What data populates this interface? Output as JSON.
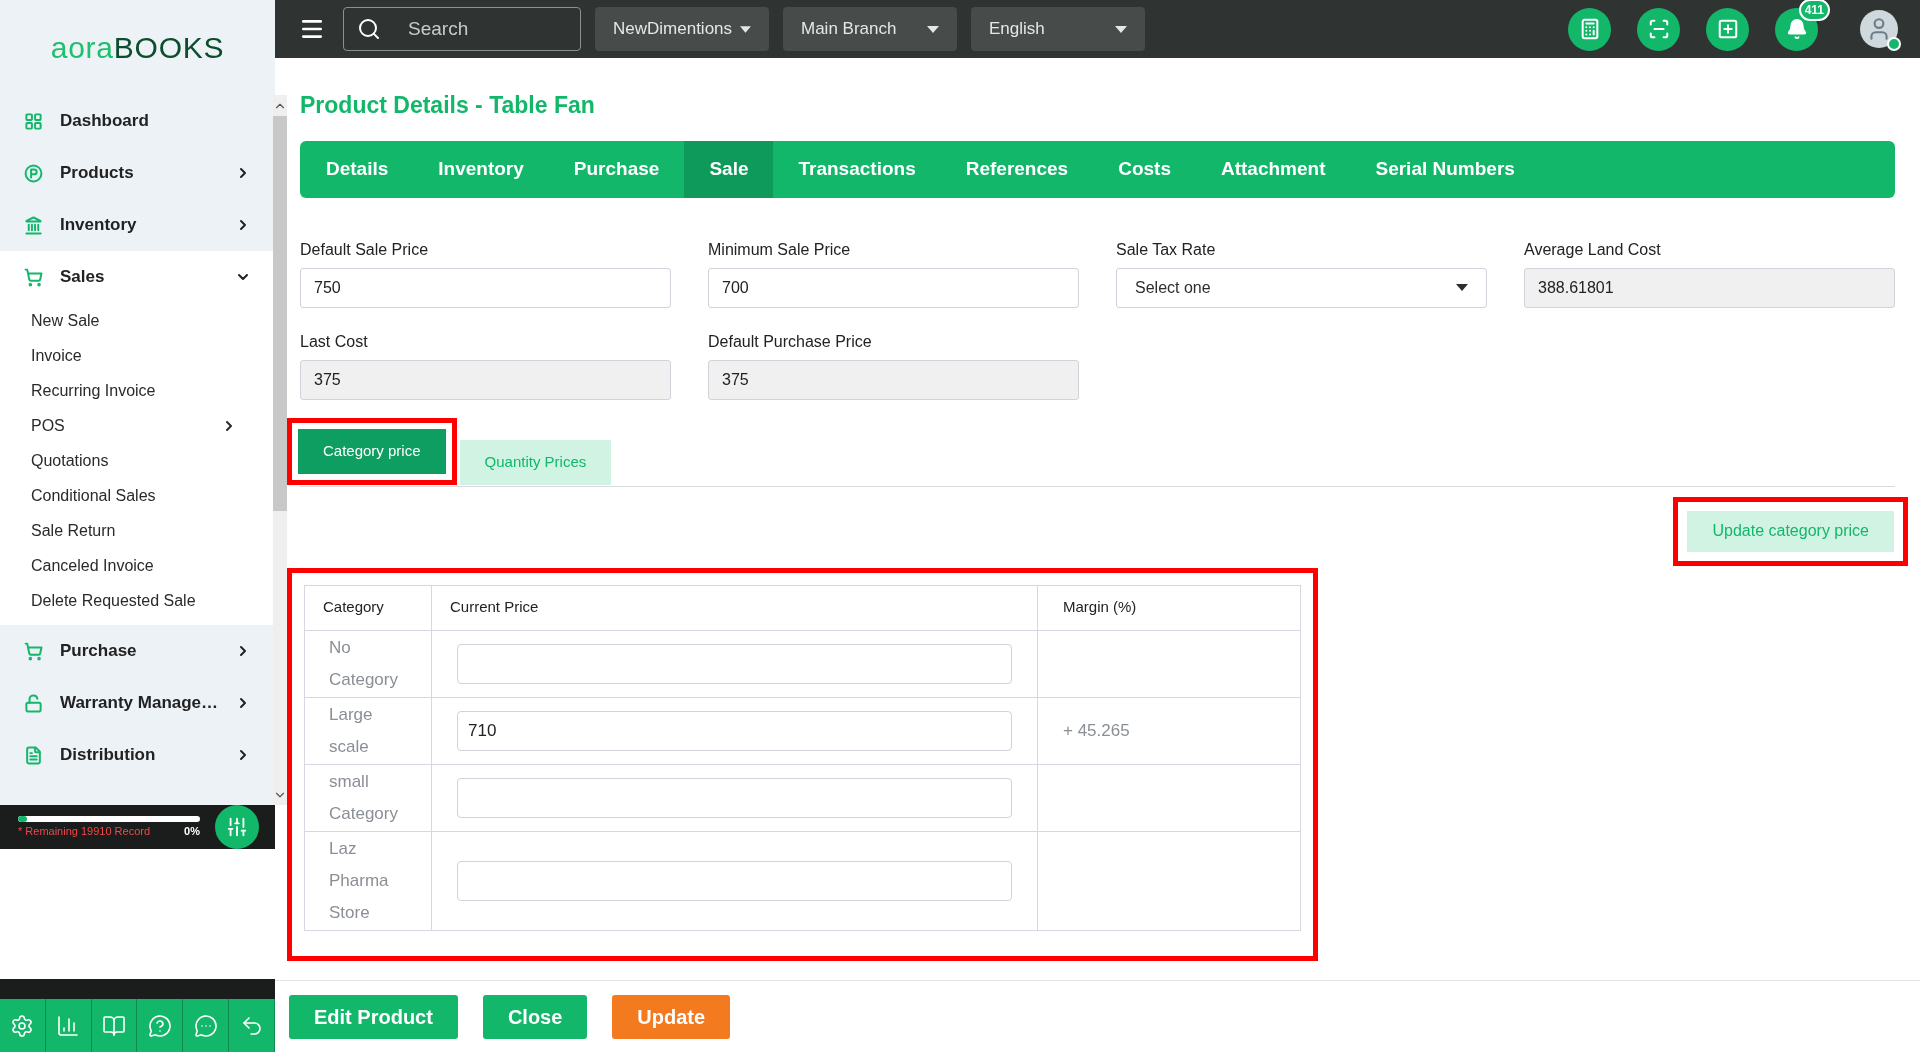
{
  "logo": {
    "part1": "aora",
    "part2": "BOOKS"
  },
  "topbar": {
    "search": {
      "placeholder": "Search"
    },
    "dropdowns": [
      "NewDimentions",
      "Main Branch",
      "English"
    ],
    "notification_count": "411"
  },
  "sidebar": {
    "items": [
      {
        "label": "Dashboard"
      },
      {
        "label": "Products",
        "expanded": false
      },
      {
        "label": "Inventory",
        "expanded": false
      },
      {
        "label": "Sales",
        "expanded": true,
        "children": [
          {
            "label": "New Sale"
          },
          {
            "label": "Invoice"
          },
          {
            "label": "Recurring Invoice"
          },
          {
            "label": "POS",
            "expanded": false
          },
          {
            "label": "Quotations"
          },
          {
            "label": "Conditional Sales"
          },
          {
            "label": "Sale Return"
          },
          {
            "label": "Canceled Invoice"
          },
          {
            "label": "Delete Requested Sale"
          }
        ]
      },
      {
        "label": "Purchase",
        "expanded": false
      },
      {
        "label": "Warranty Manage…",
        "expanded": false
      },
      {
        "label": "Distribution",
        "expanded": false
      }
    ],
    "sync": {
      "level": 0.05,
      "text": "* Remaining 19910 Record",
      "percent": "0%"
    }
  },
  "page_title": "Product Details - Table Fan",
  "tabs": [
    {
      "label": "Details",
      "selected": false
    },
    {
      "label": "Inventory",
      "selected": false
    },
    {
      "label": "Purchase",
      "selected": false
    },
    {
      "label": "Sale",
      "selected": true
    },
    {
      "label": "Transactions",
      "selected": false
    },
    {
      "label": "References",
      "selected": false
    },
    {
      "label": "Costs",
      "selected": false
    },
    {
      "label": "Attachment",
      "selected": false
    },
    {
      "label": "Serial Numbers",
      "selected": false
    }
  ],
  "fields": [
    {
      "label": "Default Sale Price",
      "value": "750",
      "kind": "input",
      "disabled": false
    },
    {
      "label": "Minimum Sale Price",
      "value": "700",
      "kind": "input",
      "disabled": false
    },
    {
      "label": "Sale Tax Rate",
      "value": "Select one",
      "kind": "select",
      "disabled": false
    },
    {
      "label": "Average Land Cost",
      "value": "388.61801",
      "kind": "input",
      "disabled": true
    },
    {
      "label": "Last Cost",
      "value": "375",
      "kind": "input",
      "disabled": true
    },
    {
      "label": "Default Purchase Price",
      "value": "375",
      "kind": "input",
      "disabled": true
    }
  ],
  "subtabs": [
    {
      "label": "Category price",
      "selected": true,
      "annotated": true
    },
    {
      "label": "Quantity Prices",
      "selected": false,
      "annotated": false
    }
  ],
  "update_button": {
    "label": "Update category price",
    "annotated": true
  },
  "table": {
    "annotated": true,
    "columns": [
      "Category",
      "Current Price",
      "Margin (%)"
    ],
    "rows": [
      {
        "category": "No Category",
        "price": "",
        "margin": ""
      },
      {
        "category": "Large scale",
        "price": "710",
        "margin": "+ 45.265"
      },
      {
        "category": "small Category",
        "price": "",
        "margin": ""
      },
      {
        "category": "Laz Pharma Store",
        "price": "",
        "margin": ""
      }
    ]
  },
  "footer_buttons": [
    {
      "label": "Edit Product",
      "kind": "primary"
    },
    {
      "label": "Close",
      "kind": "primary"
    },
    {
      "label": "Update",
      "kind": "warning"
    }
  ]
}
